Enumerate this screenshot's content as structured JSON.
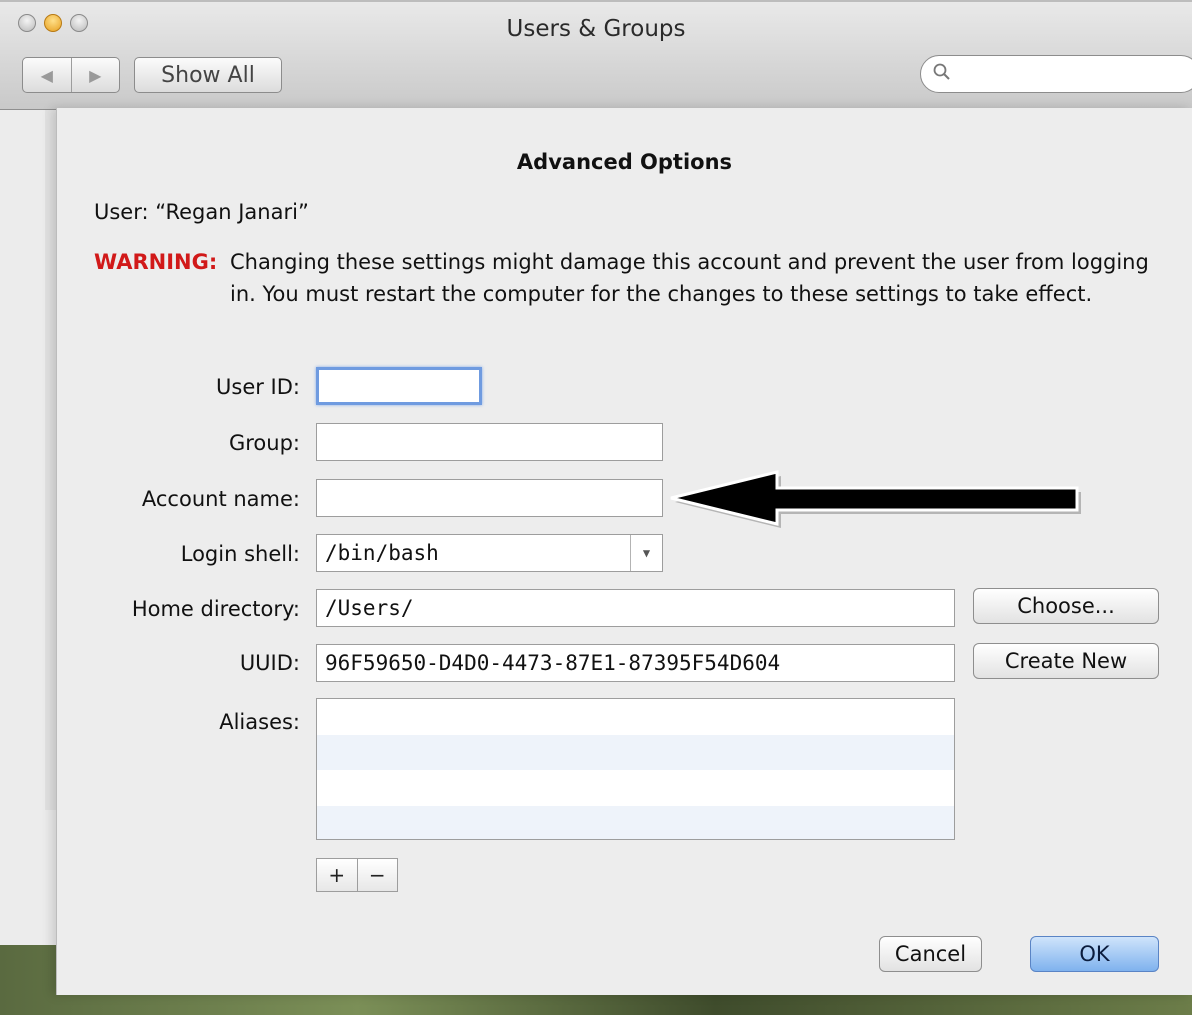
{
  "window": {
    "title": "Users & Groups",
    "show_all_label": "Show All",
    "search_placeholder": ""
  },
  "sheet": {
    "title": "Advanced Options",
    "user_line": "User: “Regan Janari”",
    "warning_label": "WARNING:",
    "warning_text": "Changing these settings might damage this account and prevent the user from logging in. You must restart the computer for the changes to these settings to take effect.",
    "fields": {
      "user_id_label": "User ID:",
      "user_id_value": "",
      "group_label": "Group:",
      "group_value": "",
      "account_name_label": "Account name:",
      "account_name_value": "",
      "login_shell_label": "Login shell:",
      "login_shell_value": "/bin/bash",
      "home_directory_label": "Home directory:",
      "home_directory_value": "/Users/",
      "uuid_label": "UUID:",
      "uuid_value": "96F59650-D4D0-4473-87E1-87395F54D604",
      "aliases_label": "Aliases:"
    },
    "buttons": {
      "choose": "Choose...",
      "create_new": "Create New",
      "add": "+",
      "remove": "−",
      "cancel": "Cancel",
      "ok": "OK"
    }
  },
  "colors": {
    "warning": "#d11919",
    "primary_button": "#7fb2ee",
    "focus_ring": "#6f9be0"
  }
}
